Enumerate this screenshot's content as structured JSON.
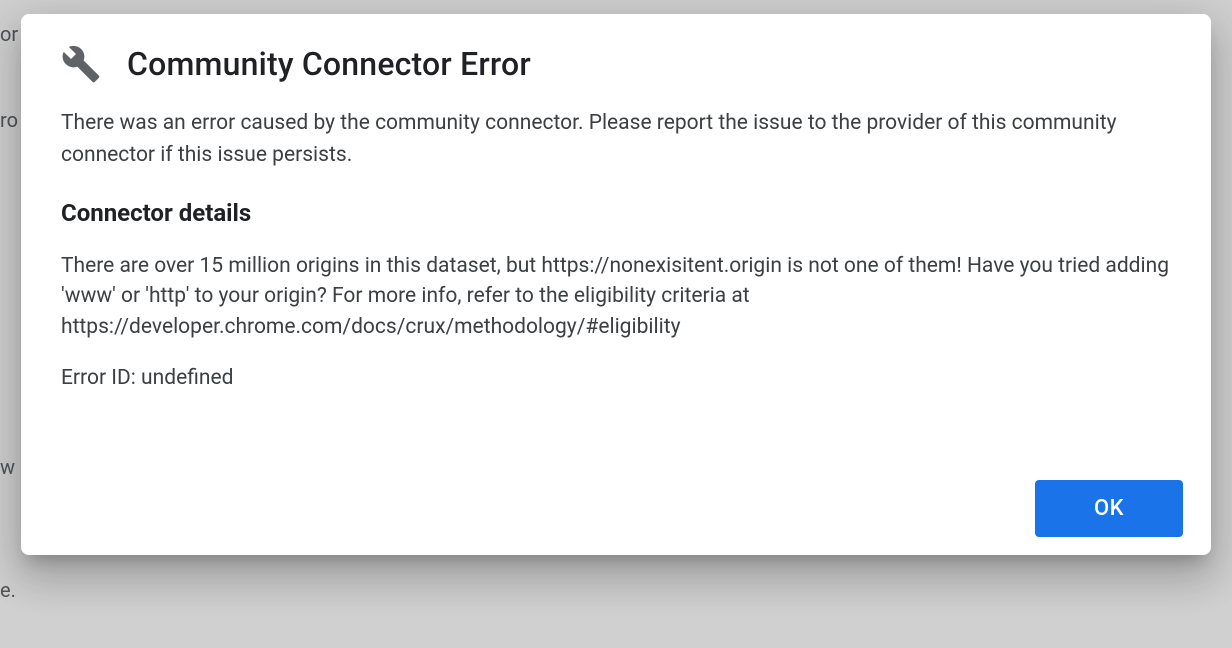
{
  "background": {
    "fragment1": "or",
    "fragment2": "ro",
    "fragment3": "w",
    "fragment4": "e."
  },
  "dialog": {
    "title": "Community Connector Error",
    "message": "There was an error caused by the community connector. Please report the issue to the provider of this community connector if this issue persists.",
    "details_heading": "Connector details",
    "details_text": "There are over 15 million origins in this dataset, but https://nonexisitent.origin is not one of them! Have you tried adding 'www' or 'http' to your origin? For more info, refer to the eligibility criteria at https://developer.chrome.com/docs/crux/methodology/#eligibility",
    "error_id_label": "Error ID: undefined",
    "ok_button": "OK"
  }
}
